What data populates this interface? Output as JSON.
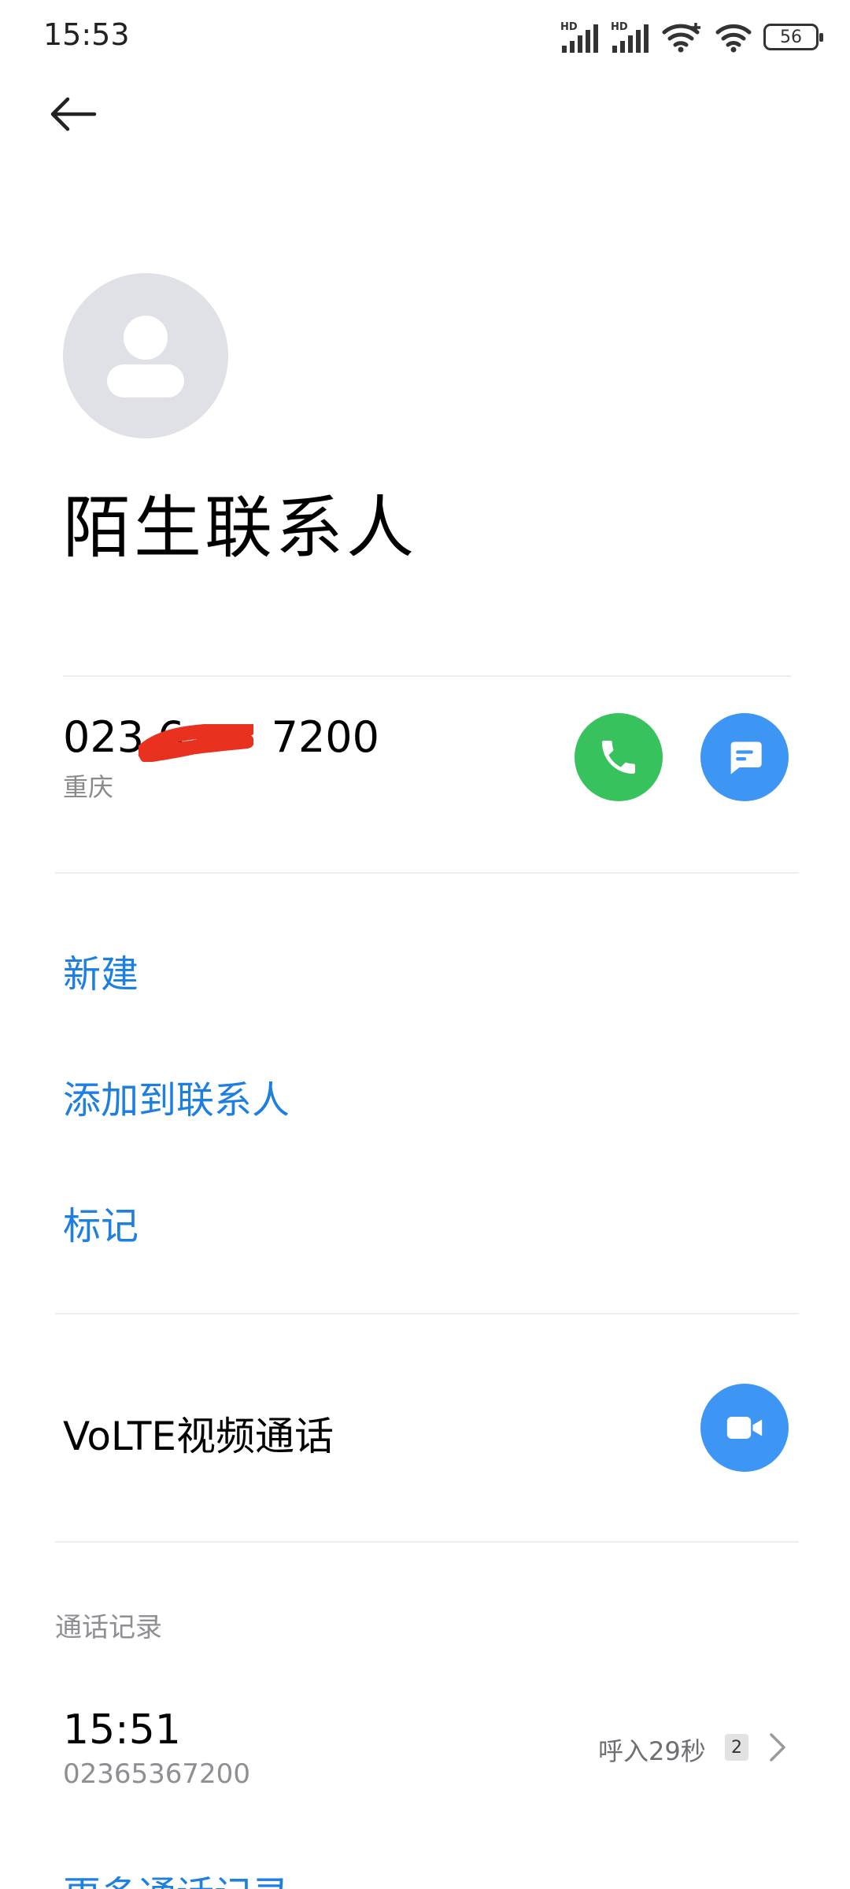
{
  "status_bar": {
    "time": "15:53",
    "signal1_label": "HD",
    "signal2_label": "HD",
    "battery": "56"
  },
  "contact": {
    "name": "陌生联系人",
    "avatar_icon": "person-icon"
  },
  "number": {
    "visible_prefix": "023 6",
    "visible_suffix": "7200",
    "location": "重庆",
    "call_icon": "phone-icon",
    "message_icon": "message-icon"
  },
  "actions": [
    {
      "label": "新建"
    },
    {
      "label": "添加到联系人"
    },
    {
      "label": "标记"
    }
  ],
  "volte": {
    "label": "VoLTE视频通话",
    "icon": "video-camera-icon"
  },
  "call_log": {
    "section_title": "通话记录",
    "entries": [
      {
        "time": "15:51",
        "number": "02365367200",
        "status": "呼入29秒",
        "count": "2"
      }
    ],
    "more_label": "更多通话记录"
  },
  "colors": {
    "accent_blue": "#1d7fe0",
    "call_green": "#38c25d",
    "button_blue": "#3d95f4",
    "redaction_red": "#e8311f",
    "avatar_gray": "#dfe1e6"
  }
}
